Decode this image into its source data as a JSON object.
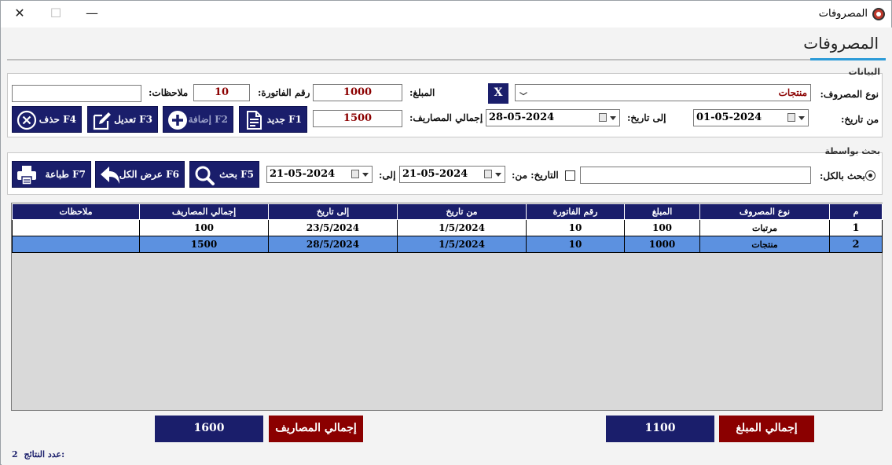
{
  "window": {
    "title": "المصروفات",
    "close_glyph": "✕",
    "maximize_glyph": "☐",
    "minimize_glyph": "—"
  },
  "page": {
    "title": "المصروفات"
  },
  "data_group": {
    "title": "البيانات",
    "expense_type_label": "نوع المصروف:",
    "expense_type_value": "منتجات",
    "clear_button": "X",
    "amount_label": "المبلغ:",
    "amount_value": "1000",
    "invoice_no_label": "رقم الفاتورة:",
    "invoice_no_value": "10",
    "notes_label": "ملاحظات:",
    "notes_value": "",
    "from_date_label": "من تاريخ:",
    "from_date_value": "01-05-2024",
    "to_date_label": "إلى تاريخ:",
    "to_date_value": "28-05-2024",
    "total_expenses_label": "إجمالي المصاريف:",
    "total_expenses_value": "1500",
    "buttons": {
      "new": "جديد F1",
      "add": "إضافة F2",
      "edit": "تعديل F3",
      "delete": "حذف F4"
    }
  },
  "search_group": {
    "title": "بحث بواسطة",
    "search_all_label": "بحث بالكل:",
    "search_all_value": "",
    "date_from_label": "التاريخ: من:",
    "date_from_value": "21-05-2024",
    "date_to_label": "إلى:",
    "date_to_value": "21-05-2024",
    "buttons": {
      "search": "بحث F5",
      "show_all": "عرض الكل F6",
      "print": "طباعة F7"
    }
  },
  "table": {
    "columns": [
      "م",
      "نوع المصروف",
      "المبلغ",
      "رقم الفاتورة",
      "من تاريخ",
      "إلى تاريخ",
      "إجمالي المصاريف",
      "ملاحظات"
    ],
    "rows": [
      [
        "1",
        "مرتبات",
        "100",
        "10",
        "1/5/2024",
        "23/5/2024",
        "100",
        ""
      ],
      [
        "2",
        "منتجات",
        "1000",
        "10",
        "1/5/2024",
        "28/5/2024",
        "1500",
        ""
      ]
    ],
    "selected_row": 2
  },
  "totals": {
    "total_amount_label": "إجمالي المبلغ",
    "total_amount_value": "1100",
    "total_expenses_label": "إجمالي المصاريف",
    "total_expenses_value": "1600"
  },
  "footer": {
    "results_count_label": "عدد النتائج:",
    "results_count_value": "2"
  },
  "colors": {
    "navy": "#1a1e6b",
    "dark_red": "#8b0000",
    "selection": "#5c91e0",
    "accent": "#2d9bd7"
  },
  "icons": {
    "app": "app-logo-icon",
    "new": "new-document-icon",
    "add": "plus-circle-icon",
    "edit": "edit-pencil-icon",
    "delete": "x-circle-icon",
    "search": "magnifier-icon",
    "show_all": "back-arrow-icon",
    "print": "printer-icon"
  }
}
